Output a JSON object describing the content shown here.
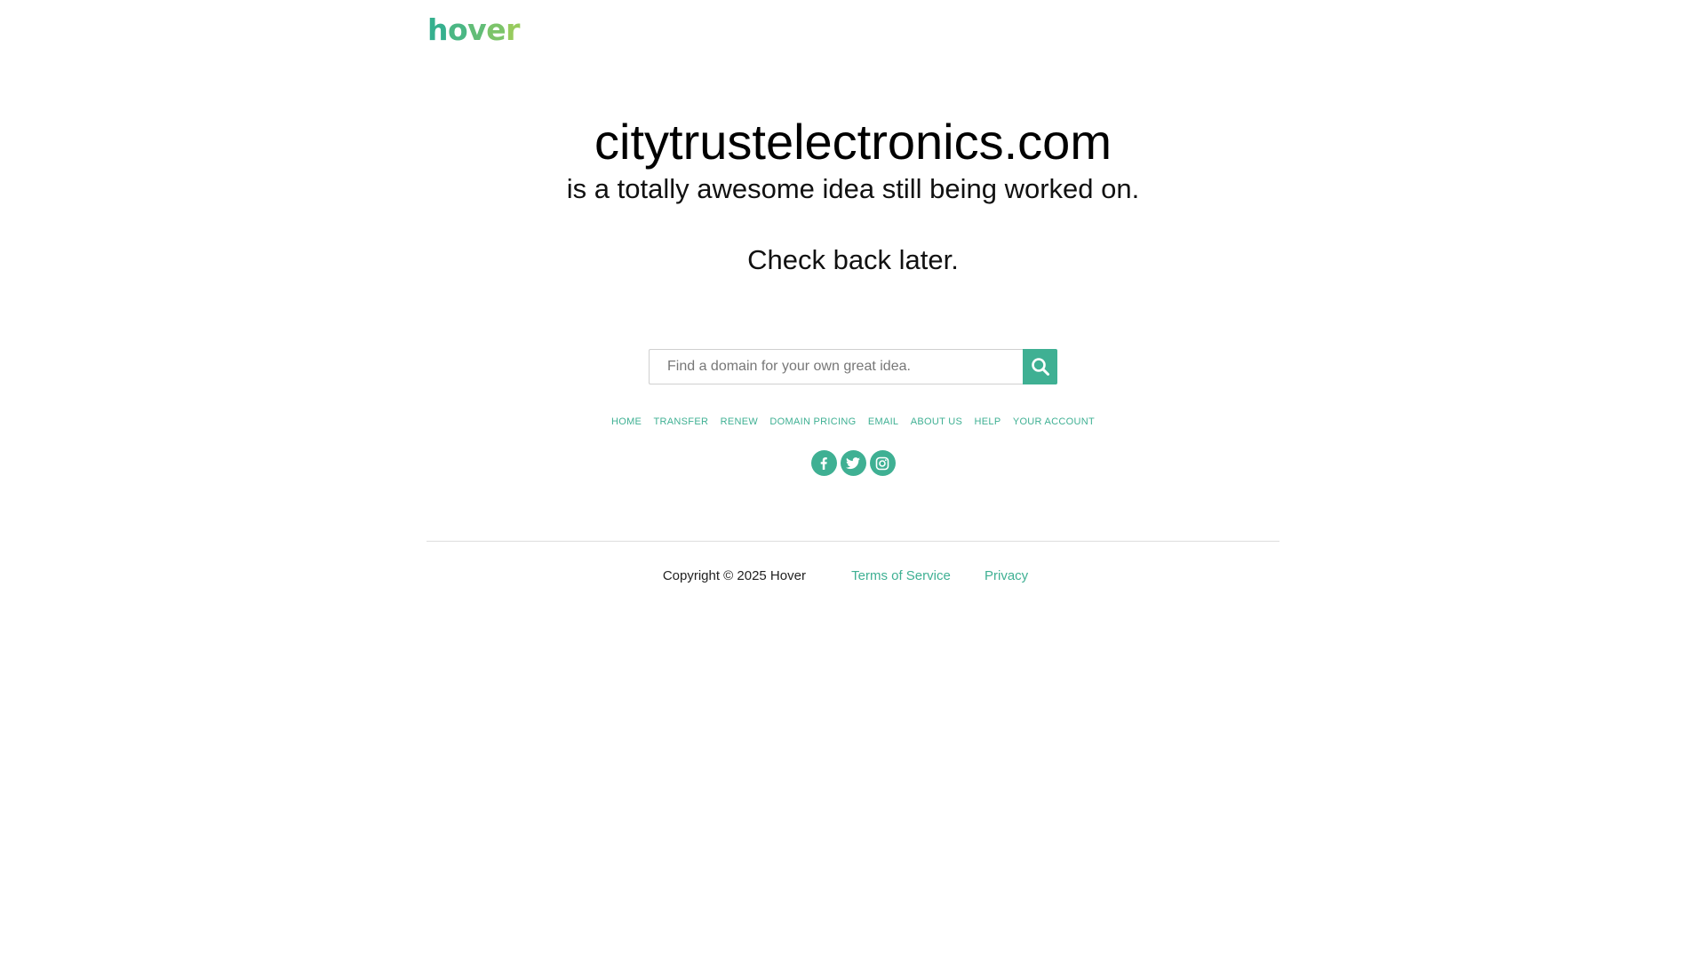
{
  "brand": {
    "logo_letters": [
      "h",
      "o",
      "v",
      "e",
      "r"
    ],
    "logo_colors": [
      "#36b08e",
      "#4bb784",
      "#62bd77",
      "#7cc46a",
      "#97cb5e"
    ]
  },
  "hero": {
    "domain": "citytrustelectronics.com",
    "tagline": "is a totally awesome idea still being worked on.",
    "check_back": "Check back later."
  },
  "search": {
    "placeholder": "Find a domain for your own great idea.",
    "button_icon": "search-icon"
  },
  "nav": {
    "items": [
      {
        "label": "HOME"
      },
      {
        "label": "TRANSFER"
      },
      {
        "label": "RENEW"
      },
      {
        "label": "DOMAIN PRICING"
      },
      {
        "label": "EMAIL"
      },
      {
        "label": "ABOUT US"
      },
      {
        "label": "HELP"
      },
      {
        "label": "YOUR ACCOUNT"
      }
    ]
  },
  "social": {
    "items": [
      {
        "icon": "facebook-icon"
      },
      {
        "icon": "twitter-icon"
      },
      {
        "icon": "instagram-icon"
      }
    ]
  },
  "footer": {
    "copyright": "Copyright © 2025 Hover",
    "terms": "Terms of Service",
    "privacy": "Privacy"
  },
  "colors": {
    "accent": "#3fb093",
    "divider": "#dddddd",
    "text": "#111111"
  }
}
